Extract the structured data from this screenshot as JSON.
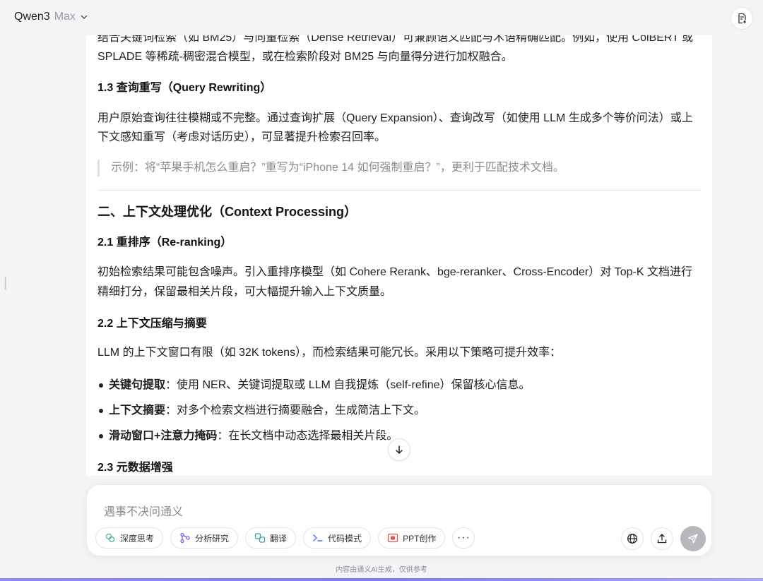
{
  "header": {
    "model_name": "Qwen3",
    "model_variant": "Max",
    "chevron_icon": "chevron-down-icon",
    "action_icon": "document-edit-icon"
  },
  "article": {
    "line_a1": "结合关键词检索（如 BM25）与向量检索（Dense Retrieval）可兼顾语义匹配与术语精确匹配。例如，使用 ColBERT 或",
    "line_a2": "SPLADE 等稀疏-稠密混合模型，或在检索阶段对 BM25 与向量得分进行加权融合。",
    "h_13": "1.3 查询重写（Query Rewriting）",
    "p_13_1": "用户原始查询往往模糊或不完整。通过查询扩展（Query Expansion）、查询改写（如使用 LLM 生成多个等价问法）或上",
    "p_13_2": "下文感知重写（考虑对话历史），可显著提升检索召回率。",
    "quote": "示例：将“苹果手机怎么重启？”重写为“iPhone 14 如何强制重启？”，更利于匹配技术文档。",
    "h2_section": "二、上下文处理优化（Context Processing）",
    "h_21": "2.1 重排序（Re-ranking）",
    "p_21_1": "初始检索结果可能包含噪声。引入重排序模型（如 Cohere Rerank、bge-reranker、Cross-Encoder）对 Top-K 文档进行",
    "p_21_2": "精细打分，保留最相关片段，可大幅提升输入上下文质量。",
    "h_22": "2.2 上下文压缩与摘要",
    "p_22": "LLM 的上下文窗口有限（如 32K tokens），而检索结果可能冗长。采用以下策略可提升效率：",
    "bullets": [
      {
        "bold": "关键句提取",
        "text": "：使用 NER、关键词提取或 LLM 自我提炼（self-refine）保留核心信息。"
      },
      {
        "bold": "上下文摘要",
        "text": "：对多个检索文档进行摘要融合，生成简洁上下文。"
      },
      {
        "bold": "滑动窗口+注意力掩码",
        "text": "：在长文档中动态选择最相关片段。"
      }
    ],
    "h_23": "2.3 元数据增强"
  },
  "composer": {
    "placeholder": "遇事不决问通义",
    "chips": [
      {
        "label": "深度思考",
        "icon": "deep-think-icon",
        "color": "#4bb58a"
      },
      {
        "label": "分析研究",
        "icon": "research-icon",
        "color": "#7a5cf0"
      },
      {
        "label": "翻译",
        "icon": "translate-icon",
        "color": "#3aa6a0"
      },
      {
        "label": "代码模式",
        "icon": "code-icon",
        "color": "#3b6ef0"
      },
      {
        "label": "PPT创作",
        "icon": "ppt-icon",
        "color": "#e2504c"
      }
    ],
    "more_label": "···",
    "globe_icon": "globe-icon",
    "upload_icon": "upload-icon",
    "send_icon": "send-icon"
  },
  "footer": {
    "note": "内容由通义AI生成，仅供参考"
  },
  "colors": {
    "accent_gradient": "#8e8bf5",
    "send_button": "#b7b7bd"
  }
}
